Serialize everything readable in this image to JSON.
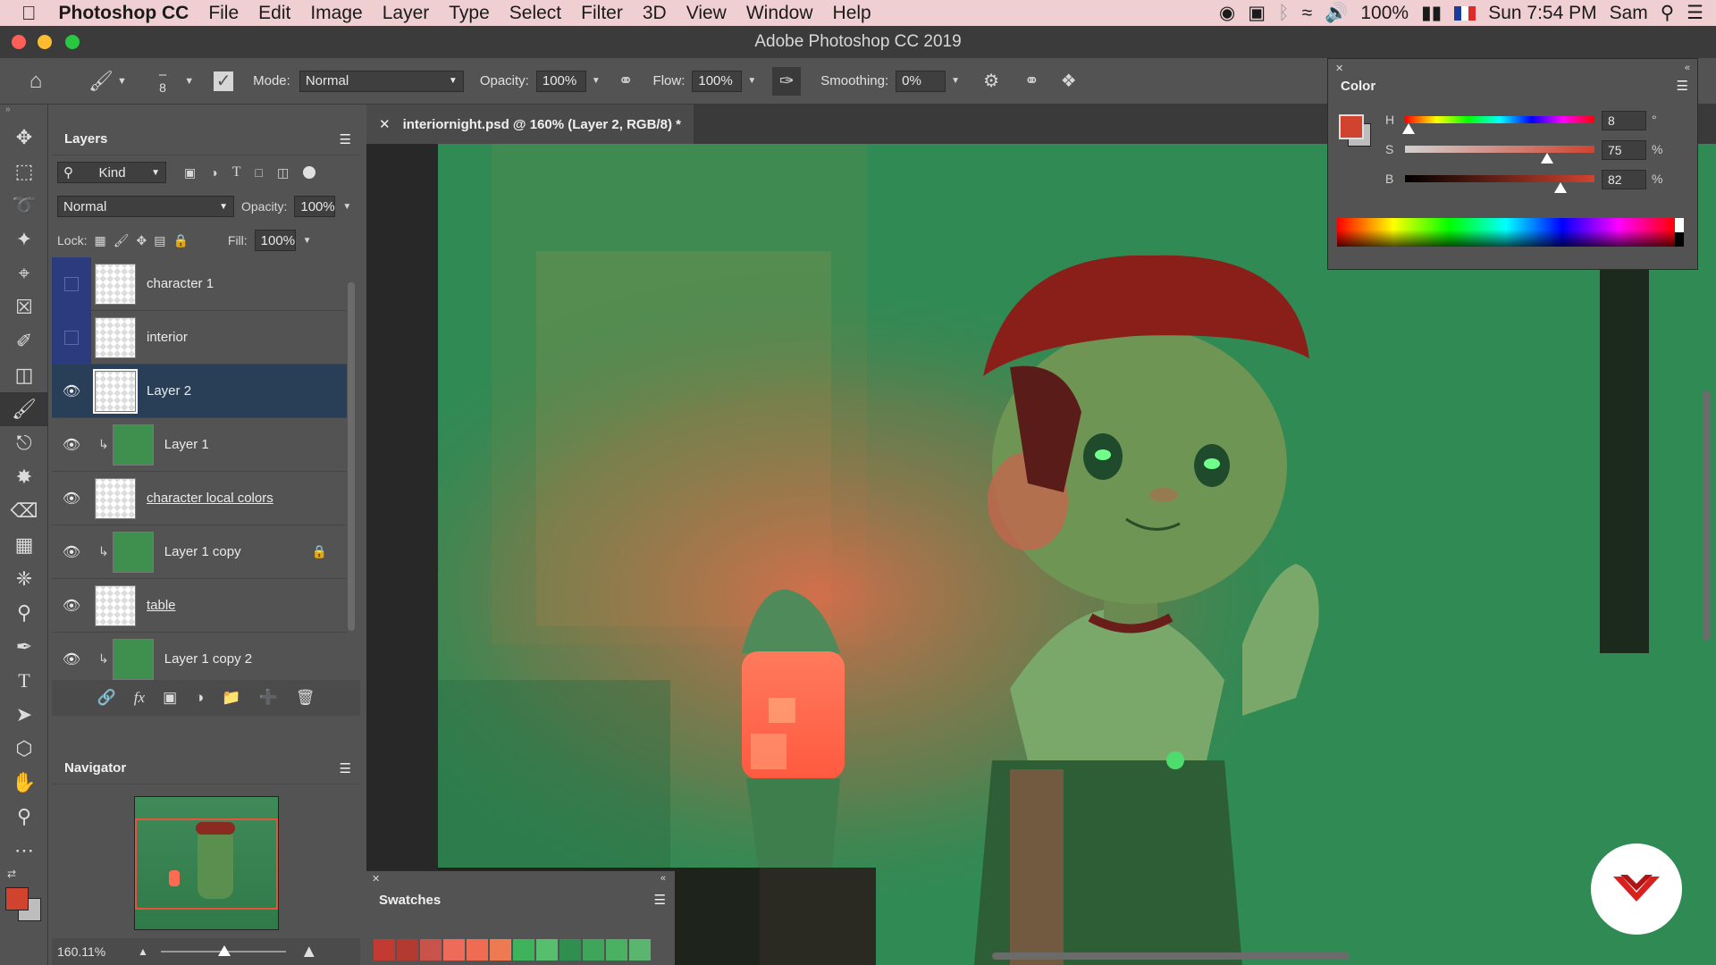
{
  "menubar": {
    "app_name": "Photoshop CC",
    "items": [
      "File",
      "Edit",
      "Image",
      "Layer",
      "Type",
      "Select",
      "Filter",
      "3D",
      "View",
      "Window",
      "Help"
    ],
    "battery": "100%",
    "clock": "Sun 7:54 PM",
    "user": "Sam"
  },
  "window": {
    "title": "Adobe Photoshop CC 2019"
  },
  "options": {
    "brush_size": "8",
    "mode_label": "Mode:",
    "mode_value": "Normal",
    "opacity_label": "Opacity:",
    "opacity_value": "100%",
    "flow_label": "Flow:",
    "flow_value": "100%",
    "smoothing_label": "Smoothing:",
    "smoothing_value": "0%"
  },
  "layers_panel": {
    "title": "Layers",
    "filter_kind": "Kind",
    "blend_mode": "Normal",
    "opacity_label": "Opacity:",
    "opacity_value": "100%",
    "lock_label": "Lock:",
    "fill_label": "Fill:",
    "fill_value": "100%",
    "layers": [
      {
        "name": "character 1",
        "visible": false,
        "clipped": false,
        "underline": false
      },
      {
        "name": "interior",
        "visible": false,
        "clipped": false,
        "underline": false
      },
      {
        "name": "Layer 2",
        "visible": true,
        "clipped": false,
        "selected": true,
        "underline": false
      },
      {
        "name": "Layer 1",
        "visible": true,
        "clipped": true,
        "underline": false
      },
      {
        "name": "character local colors",
        "visible": true,
        "clipped": false,
        "underline": true
      },
      {
        "name": "Layer 1 copy",
        "visible": true,
        "clipped": true,
        "locked": true,
        "underline": false
      },
      {
        "name": "table",
        "visible": true,
        "clipped": false,
        "underline": true
      },
      {
        "name": "Layer 1 copy 2",
        "visible": true,
        "clipped": true,
        "underline": false
      }
    ]
  },
  "navigator": {
    "title": "Navigator",
    "zoom": "160.11%"
  },
  "document": {
    "tab_title": "interiornight.psd @ 160% (Layer 2, RGB/8) *"
  },
  "color_panel": {
    "title": "Color",
    "h_label": "H",
    "h_value": "8",
    "h_unit": "°",
    "h_level": 0.02,
    "s_label": "S",
    "s_value": "75",
    "s_unit": "%",
    "s_level": 0.75,
    "b_label": "B",
    "b_value": "82",
    "b_unit": "%",
    "b_level": 0.82,
    "foreground": "#d0432f",
    "background": "#bdbdbd"
  },
  "swatches_panel": {
    "title": "Swatches",
    "colors": [
      "#c33a33",
      "#b33a30",
      "#c9524a",
      "#ee6b5a",
      "#ef6c52",
      "#ed7a50",
      "#3fb35b",
      "#57be6d",
      "#2e8f4e",
      "#3fa55a",
      "#4ab062",
      "#5ab66e"
    ]
  }
}
